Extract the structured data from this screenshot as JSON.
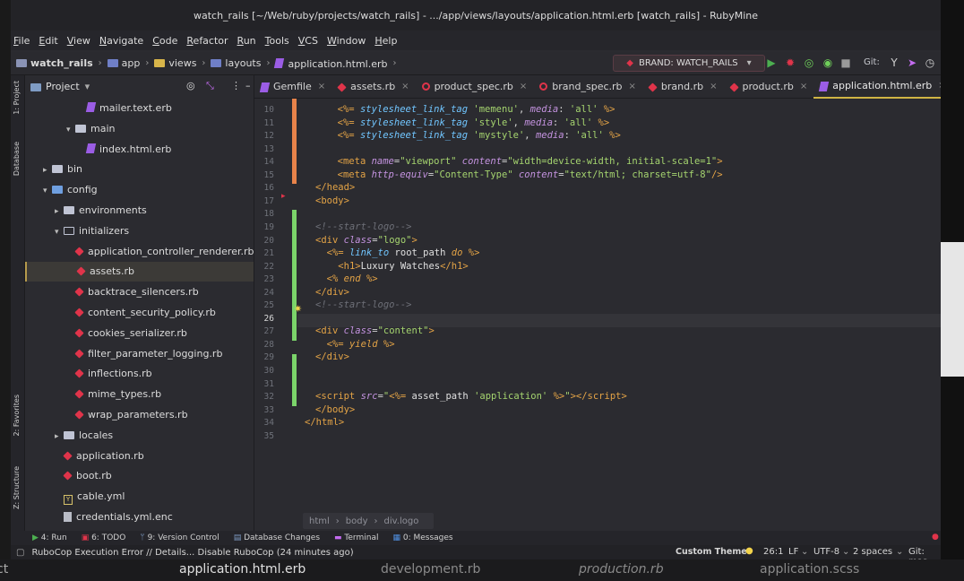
{
  "window_title": "watch_rails [~/Web/ruby/projects/watch_rails] - .../app/views/layouts/application.html.erb [watch_rails] - RubyMine",
  "menu": [
    "File",
    "Edit",
    "View",
    "Navigate",
    "Code",
    "Refactor",
    "Run",
    "Tools",
    "VCS",
    "Window",
    "Help"
  ],
  "breadcrumbs": [
    "watch_rails",
    "app",
    "views",
    "layouts",
    "application.html.erb"
  ],
  "run_config": "BRAND: WATCH_RAILS",
  "git_label": "Git:",
  "left_tool_tabs": [
    "1: Project",
    "Database",
    "2: Favorites",
    "Z: Structure"
  ],
  "project_panel": {
    "title": "Project",
    "tree": [
      {
        "label": "mailer.text.erb",
        "indent": 5,
        "icon": "erb",
        "arrow": ""
      },
      {
        "label": "main",
        "indent": 4,
        "icon": "folder",
        "arrow": "▾"
      },
      {
        "label": "index.html.erb",
        "indent": 5,
        "icon": "erb",
        "arrow": ""
      },
      {
        "label": "bin",
        "indent": 2,
        "icon": "folder",
        "arrow": "▸"
      },
      {
        "label": "config",
        "indent": 2,
        "icon": "folder-blue",
        "arrow": "▾"
      },
      {
        "label": "environments",
        "indent": 3,
        "icon": "folder",
        "arrow": "▸"
      },
      {
        "label": "initializers",
        "indent": 3,
        "icon": "folder-outline",
        "arrow": "▾"
      },
      {
        "label": "application_controller_renderer.rb",
        "indent": 4,
        "icon": "ruby",
        "arrow": ""
      },
      {
        "label": "assets.rb",
        "indent": 4,
        "icon": "ruby",
        "arrow": "",
        "selected": true
      },
      {
        "label": "backtrace_silencers.rb",
        "indent": 4,
        "icon": "ruby",
        "arrow": ""
      },
      {
        "label": "content_security_policy.rb",
        "indent": 4,
        "icon": "ruby",
        "arrow": ""
      },
      {
        "label": "cookies_serializer.rb",
        "indent": 4,
        "icon": "ruby",
        "arrow": ""
      },
      {
        "label": "filter_parameter_logging.rb",
        "indent": 4,
        "icon": "ruby",
        "arrow": ""
      },
      {
        "label": "inflections.rb",
        "indent": 4,
        "icon": "ruby",
        "arrow": ""
      },
      {
        "label": "mime_types.rb",
        "indent": 4,
        "icon": "ruby",
        "arrow": ""
      },
      {
        "label": "wrap_parameters.rb",
        "indent": 4,
        "icon": "ruby",
        "arrow": ""
      },
      {
        "label": "locales",
        "indent": 3,
        "icon": "folder",
        "arrow": "▸"
      },
      {
        "label": "application.rb",
        "indent": 3,
        "icon": "ruby",
        "arrow": ""
      },
      {
        "label": "boot.rb",
        "indent": 3,
        "icon": "ruby",
        "arrow": ""
      },
      {
        "label": "cable.yml",
        "indent": 3,
        "icon": "yml",
        "arrow": ""
      },
      {
        "label": "credentials.yml.enc",
        "indent": 3,
        "icon": "enc",
        "arrow": ""
      }
    ]
  },
  "tabs": [
    {
      "label": "Gemfile",
      "icon": "erb"
    },
    {
      "label": "assets.rb",
      "icon": "ruby"
    },
    {
      "label": "product_spec.rb",
      "icon": "spec"
    },
    {
      "label": "brand_spec.rb",
      "icon": "spec"
    },
    {
      "label": "brand.rb",
      "icon": "ruby"
    },
    {
      "label": "product.rb",
      "icon": "ruby"
    },
    {
      "label": "application.html.erb",
      "icon": "erb",
      "active": true
    }
  ],
  "editor": {
    "current_line": 26,
    "lines": [
      {
        "n": 10,
        "html": "  <span class='erb'>&lt;%=</span> <span class='meth'>stylesheet_link_tag</span> <span class='str'>'memenu'</span>, <span class='attr'>media</span>: <span class='str'>'all'</span> <span class='erb'>%&gt;</span>"
      },
      {
        "n": 11,
        "html": "  <span class='erb'>&lt;%=</span> <span class='meth'>stylesheet_link_tag</span> <span class='str'>'style'</span>, <span class='attr'>media</span>: <span class='str'>'all'</span> <span class='erb'>%&gt;</span>"
      },
      {
        "n": 12,
        "html": "  <span class='erb'>&lt;%=</span> <span class='meth'>stylesheet_link_tag</span> <span class='str'>'mystyle'</span>, <span class='attr'>media</span>: <span class='str'>'all'</span> <span class='erb'>%&gt;</span>"
      },
      {
        "n": 13,
        "html": ""
      },
      {
        "n": 14,
        "html": "  <span class='tag'>&lt;meta</span> <span class='attr'>name</span>=<span class='str'>\"viewport\"</span> <span class='attr'>content</span>=<span class='str'>\"width=device-width, initial-scale=1\"</span><span class='tag'>&gt;</span>"
      },
      {
        "n": 15,
        "html": "  <span class='tag'>&lt;meta</span> <span class='attr'>http-equiv</span>=<span class='str'>\"Content-Type\"</span> <span class='attr'>content</span>=<span class='str'>\"text/html; charset=utf-8\"</span><span class='tag'>/&gt;</span>"
      },
      {
        "n": 16,
        "html": "<span class='tag'>&lt;/head&gt;</span>"
      },
      {
        "n": 17,
        "html": "<span class='tag'>&lt;body&gt;</span>"
      },
      {
        "n": 18,
        "html": ""
      },
      {
        "n": 19,
        "html": "<span class='cmt'>&lt;!--start-logo--&gt;</span>"
      },
      {
        "n": 20,
        "html": "<span class='tag'>&lt;div</span> <span class='attr'>class</span>=<span class='str'>\"logo\"</span><span class='tag'>&gt;</span>"
      },
      {
        "n": 21,
        "html": "  <span class='erb'>&lt;%=</span> <span class='meth'>link_to</span> <span class='plain'>root_path</span> <span class='kw'>do</span> <span class='erb'>%&gt;</span>"
      },
      {
        "n": 22,
        "html": "    <span class='tag'>&lt;h1&gt;</span><span class='plain'>Luxury Watches</span><span class='tag'>&lt;/h1&gt;</span>"
      },
      {
        "n": 23,
        "html": "  <span class='erb'>&lt;%</span> <span class='kw'>end</span> <span class='erb'>%&gt;</span>"
      },
      {
        "n": 24,
        "html": "<span class='tag'>&lt;/div&gt;</span>"
      },
      {
        "n": 25,
        "html": "<span class='cmt'>&lt;!--start-logo--&gt;</span>"
      },
      {
        "n": 26,
        "html": ""
      },
      {
        "n": 27,
        "html": "<span class='tag'>&lt;div</span> <span class='attr'>class</span>=<span class='str'>\"content\"</span><span class='tag'>&gt;</span>"
      },
      {
        "n": 28,
        "html": "  <span class='erb'>&lt;%=</span> <span class='kw'>yield</span> <span class='erb'>%&gt;</span>"
      },
      {
        "n": 29,
        "html": "<span class='tag'>&lt;/div&gt;</span>"
      },
      {
        "n": 30,
        "html": ""
      },
      {
        "n": 31,
        "html": ""
      },
      {
        "n": 32,
        "html": "<span class='tag'>&lt;script</span> <span class='attr'>src</span>=<span class='str'>\"</span><span class='erb'>&lt;%=</span> <span class='plain'>asset_path</span> <span class='str'>'application'</span> <span class='erb'>%&gt;</span><span class='str'>\"</span><span class='tag'>&gt;&lt;/script&gt;</span>"
      },
      {
        "n": 33,
        "html": "<span class='tag'>&lt;/body&gt;</span>"
      },
      {
        "n": 34,
        "html": "<span class='tag'>&lt;/html&gt;</span>"
      },
      {
        "n": 35,
        "html": ""
      }
    ]
  },
  "editor_breadcrumbs": [
    "html",
    "body",
    "div.logo"
  ],
  "bottom_tools": [
    "4: Run",
    "6: TODO",
    "9: Version Control",
    "Database Changes",
    "Terminal",
    "0: Messages"
  ],
  "status": {
    "message": "RuboCop Execution Error // Details... Disable RuboCop (24 minutes ago)",
    "theme": "Custom Theme",
    "position": "26:1",
    "line_sep": "LF",
    "encoding": "UTF-8",
    "indent": "2 spaces",
    "git": "Git: mas"
  },
  "taskbar": [
    "application.html.erb",
    "development.rb",
    "production.rb",
    "application.scss"
  ],
  "colors": {
    "accent": "#d0b544",
    "ruby": "#e0344a",
    "erb": "#9b5de5",
    "added": "#7bd46a",
    "modified": "#e8834a"
  }
}
